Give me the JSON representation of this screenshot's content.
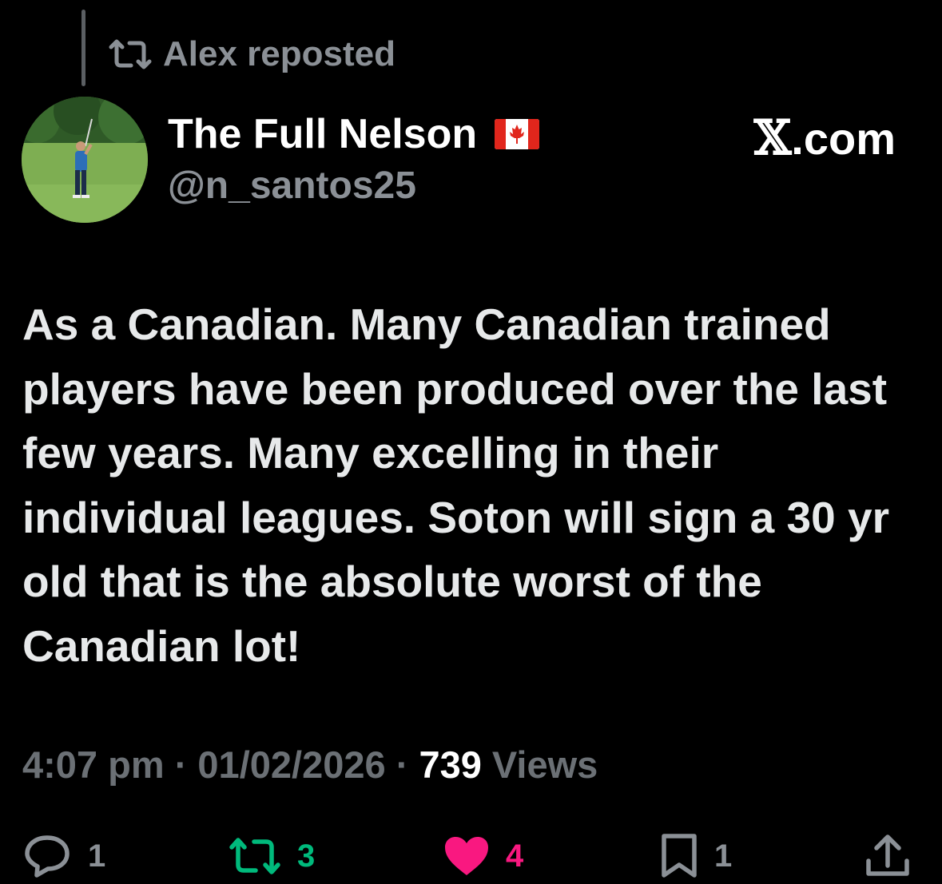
{
  "repost_banner": {
    "text": "Alex reposted",
    "icon": "repost-icon"
  },
  "author": {
    "display_name": "The Full Nelson",
    "flag": "canada-flag-icon",
    "handle": "@n_santos25",
    "avatar": "golfer-avatar"
  },
  "source": {
    "symbol": "𝕏",
    "suffix": ".com"
  },
  "tweet": {
    "text": "As a Canadian. Many Canadian trained players have been produced over the last few years. Many excelling in their individual leagues. Soton will sign a 30 yr old that is the absolute worst of the Canadian lot!"
  },
  "meta": {
    "time": "4:07 pm",
    "separator": " · ",
    "date": "01/02/2026",
    "views_count": "739",
    "views_label": " Views"
  },
  "actions": {
    "replies": "1",
    "reposts": "3",
    "likes": "4",
    "bookmarks": "1"
  },
  "colors": {
    "background": "#000000",
    "text_primary": "#e7e9ea",
    "text_secondary": "#8b9096",
    "repost_green": "#00ba7c",
    "like_pink": "#f91880"
  }
}
